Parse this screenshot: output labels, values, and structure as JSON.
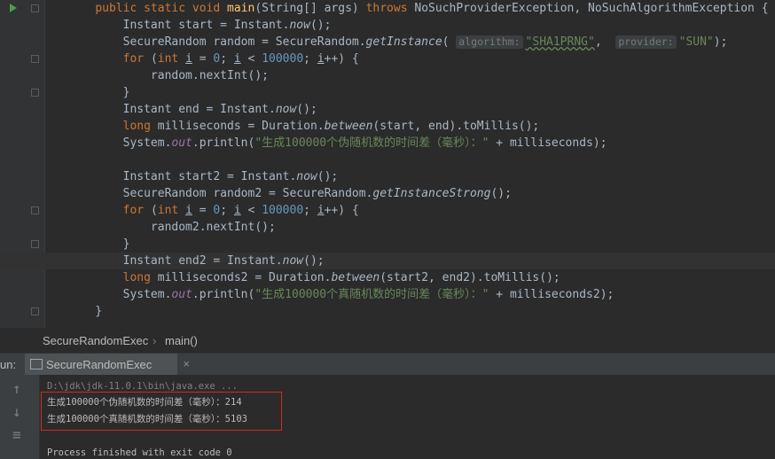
{
  "code_lines": [
    [
      {
        "t": "    "
      },
      {
        "t": "public static void ",
        "c": "kw"
      },
      {
        "t": "main",
        "c": "fn"
      },
      {
        "t": "(String[] args) "
      },
      {
        "t": "throws ",
        "c": "kw"
      },
      {
        "t": "NoSuchProviderException, NoSuchAlgorithmException {"
      }
    ],
    [
      {
        "t": "        Instant start = Instant."
      },
      {
        "t": "now",
        "c": "it"
      },
      {
        "t": "();"
      }
    ],
    [
      {
        "t": "        SecureRandom random = SecureRandom."
      },
      {
        "t": "getInstance",
        "c": "it"
      },
      {
        "t": "( "
      },
      {
        "t": "algorithm:",
        "c": "hint"
      },
      {
        "t": "\"SHA1PRNG\"",
        "c": "str green-ul"
      },
      {
        "t": ",  "
      },
      {
        "t": "provider:",
        "c": "hint"
      },
      {
        "t": "\"SUN\"",
        "c": "str"
      },
      {
        "t": ");"
      }
    ],
    [
      {
        "t": "        "
      },
      {
        "t": "for ",
        "c": "kw"
      },
      {
        "t": "("
      },
      {
        "t": "int ",
        "c": "kw"
      },
      {
        "t": "i",
        "c": "ul"
      },
      {
        "t": " = "
      },
      {
        "t": "0",
        "c": "num"
      },
      {
        "t": "; "
      },
      {
        "t": "i",
        "c": "ul"
      },
      {
        "t": " < "
      },
      {
        "t": "100000",
        "c": "num"
      },
      {
        "t": "; "
      },
      {
        "t": "i",
        "c": "ul"
      },
      {
        "t": "++) {"
      }
    ],
    [
      {
        "t": "            random.nextInt();"
      }
    ],
    [
      {
        "t": "        }"
      }
    ],
    [
      {
        "t": "        Instant end = Instant."
      },
      {
        "t": "now",
        "c": "it"
      },
      {
        "t": "();"
      }
    ],
    [
      {
        "t": "        "
      },
      {
        "t": "long ",
        "c": "kw"
      },
      {
        "t": "milliseconds = Duration."
      },
      {
        "t": "between",
        "c": "it"
      },
      {
        "t": "(start, end).toMillis();"
      }
    ],
    [
      {
        "t": "        System."
      },
      {
        "t": "out",
        "c": "fld"
      },
      {
        "t": ".println("
      },
      {
        "t": "\"生成100000个伪随机数的时间差（毫秒）：\"",
        "c": "str"
      },
      {
        "t": " + milliseconds);"
      }
    ],
    [
      {
        "t": ""
      }
    ],
    [
      {
        "t": "        Instant start2 = Instant."
      },
      {
        "t": "now",
        "c": "it"
      },
      {
        "t": "();"
      }
    ],
    [
      {
        "t": "        SecureRandom random2 = SecureRandom."
      },
      {
        "t": "getInstanceStrong",
        "c": "it"
      },
      {
        "t": "();"
      }
    ],
    [
      {
        "t": "        "
      },
      {
        "t": "for ",
        "c": "kw"
      },
      {
        "t": "("
      },
      {
        "t": "int ",
        "c": "kw"
      },
      {
        "t": "i",
        "c": "ul"
      },
      {
        "t": " = "
      },
      {
        "t": "0",
        "c": "num"
      },
      {
        "t": "; "
      },
      {
        "t": "i",
        "c": "ul"
      },
      {
        "t": " < "
      },
      {
        "t": "100000",
        "c": "num"
      },
      {
        "t": "; "
      },
      {
        "t": "i",
        "c": "ul"
      },
      {
        "t": "++) {"
      }
    ],
    [
      {
        "t": "            random2.nextInt();"
      }
    ],
    [
      {
        "t": "        }"
      }
    ],
    [
      {
        "t": "        Instant end2 = Instant."
      },
      {
        "t": "now",
        "c": "it"
      },
      {
        "t": "();"
      }
    ],
    [
      {
        "t": "        "
      },
      {
        "t": "long ",
        "c": "kw"
      },
      {
        "t": "milliseconds2 = Duration."
      },
      {
        "t": "between",
        "c": "it"
      },
      {
        "t": "(start2, end2).toMillis();"
      }
    ],
    [
      {
        "t": "        System."
      },
      {
        "t": "out",
        "c": "fld"
      },
      {
        "t": ".println("
      },
      {
        "t": "\"生成100000个真随机数的时间差（毫秒）：\"",
        "c": "str"
      },
      {
        "t": " + milliseconds2);"
      }
    ],
    [
      {
        "t": "    }"
      }
    ]
  ],
  "breadcrumb": {
    "class_name": "SecureRandomExec",
    "sep": "›",
    "method": "main()"
  },
  "run_panel": {
    "label": "un:",
    "tab_label": "SecureRandomExec",
    "tab_close": "×"
  },
  "console": {
    "command": "D:\\jdk\\jdk-11.0.1\\bin\\java.exe ...",
    "output_line_1": "生成100000个伪随机数的时间差（毫秒）：214",
    "output_line_2": "生成100000个真随机数的时间差（毫秒）：5103",
    "exit_line": "Process finished with exit code 0"
  },
  "icons": {
    "run": "run-arrow-icon",
    "up": "arrow-up-icon",
    "down": "arrow-down-icon",
    "wrap": "soft-wrap-icon"
  }
}
